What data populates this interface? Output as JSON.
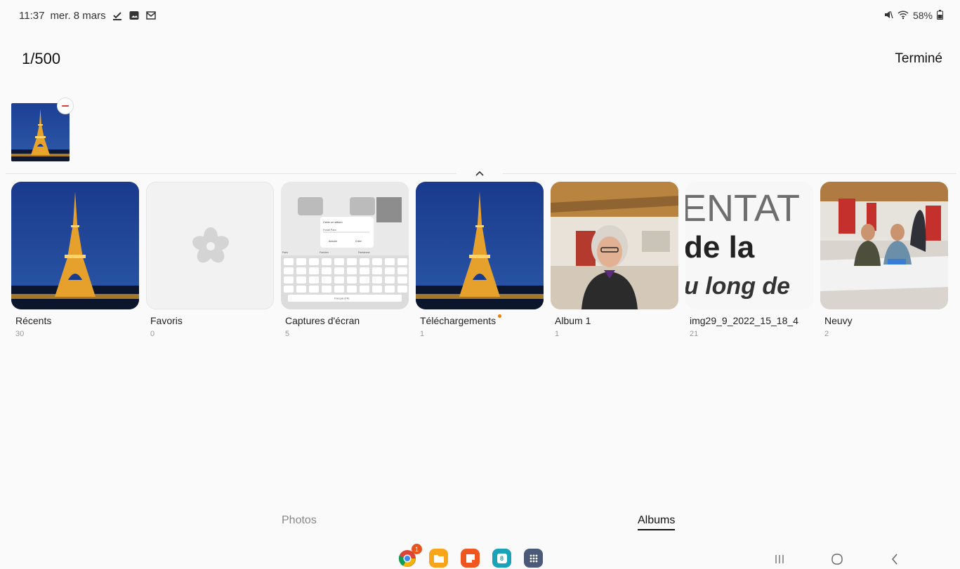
{
  "status_bar": {
    "time": "11:37",
    "date": "mer. 8 mars",
    "battery": "58%"
  },
  "header": {
    "counter": "1/500",
    "done_label": "Terminé"
  },
  "albums": [
    {
      "name": "Récents",
      "count": "30"
    },
    {
      "name": "Favoris",
      "count": "0"
    },
    {
      "name": "Captures d'écran",
      "count": "5"
    },
    {
      "name": "Téléchargements",
      "count": "1"
    },
    {
      "name": "Album 1",
      "count": "1"
    },
    {
      "name": "img29_9_2022_15_18_4",
      "count": "21"
    },
    {
      "name": "Neuvy",
      "count": "2"
    }
  ],
  "screenshot_thumb": {
    "dialog_title": "Créer un album",
    "dialog_input": "Portail Paris",
    "cancel": "Annuler",
    "create": "Créer",
    "keyboard_lang": "Français (FR)",
    "suggestions": [
      "Paris",
      "Parisien",
      "Parisienne"
    ]
  },
  "poster_thumb": {
    "line1": "ENTAT",
    "line2": "de la",
    "line3": "u long de"
  },
  "tabs": {
    "photos": "Photos",
    "albums": "Albums"
  },
  "dock": {
    "chrome_badge": "1",
    "calendar_day": "8"
  },
  "colors": {
    "accent_orange": "#f57c00",
    "remove_red": "#e53935"
  }
}
